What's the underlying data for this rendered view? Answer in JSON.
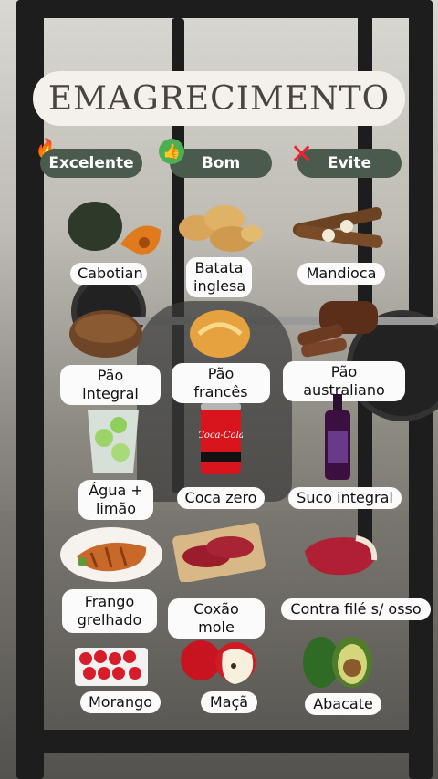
{
  "title": "EMAGRECIMENTO",
  "categories": {
    "excelente": {
      "label": "Excelente",
      "icon": "fire-icon"
    },
    "bom": {
      "label": "Bom",
      "icon": "thumbs-up-icon"
    },
    "evite": {
      "label": "Evite",
      "icon": "cross-mark-icon"
    }
  },
  "foods": {
    "cabotian": "Cabotian",
    "batata": "Batata\ninglesa",
    "mandioca": "Mandioca",
    "pao_integral": "Pão integral",
    "pao_frances": "Pão francês",
    "pao_australiano": "Pão australiano",
    "agua": "Água +\nlimão",
    "coca": "Coca zero",
    "suco": "Suco integral",
    "frango": "Frango\ngrelhado",
    "coxao": "Coxão mole",
    "contra_file": "Contra filé s/ osso",
    "morango": "Morango",
    "maca": "Maçã",
    "abacate": "Abacate"
  },
  "colors": {
    "pill": "#4a5a4c",
    "title_bg": "#f4f1ec",
    "title_text": "#4b4340"
  }
}
